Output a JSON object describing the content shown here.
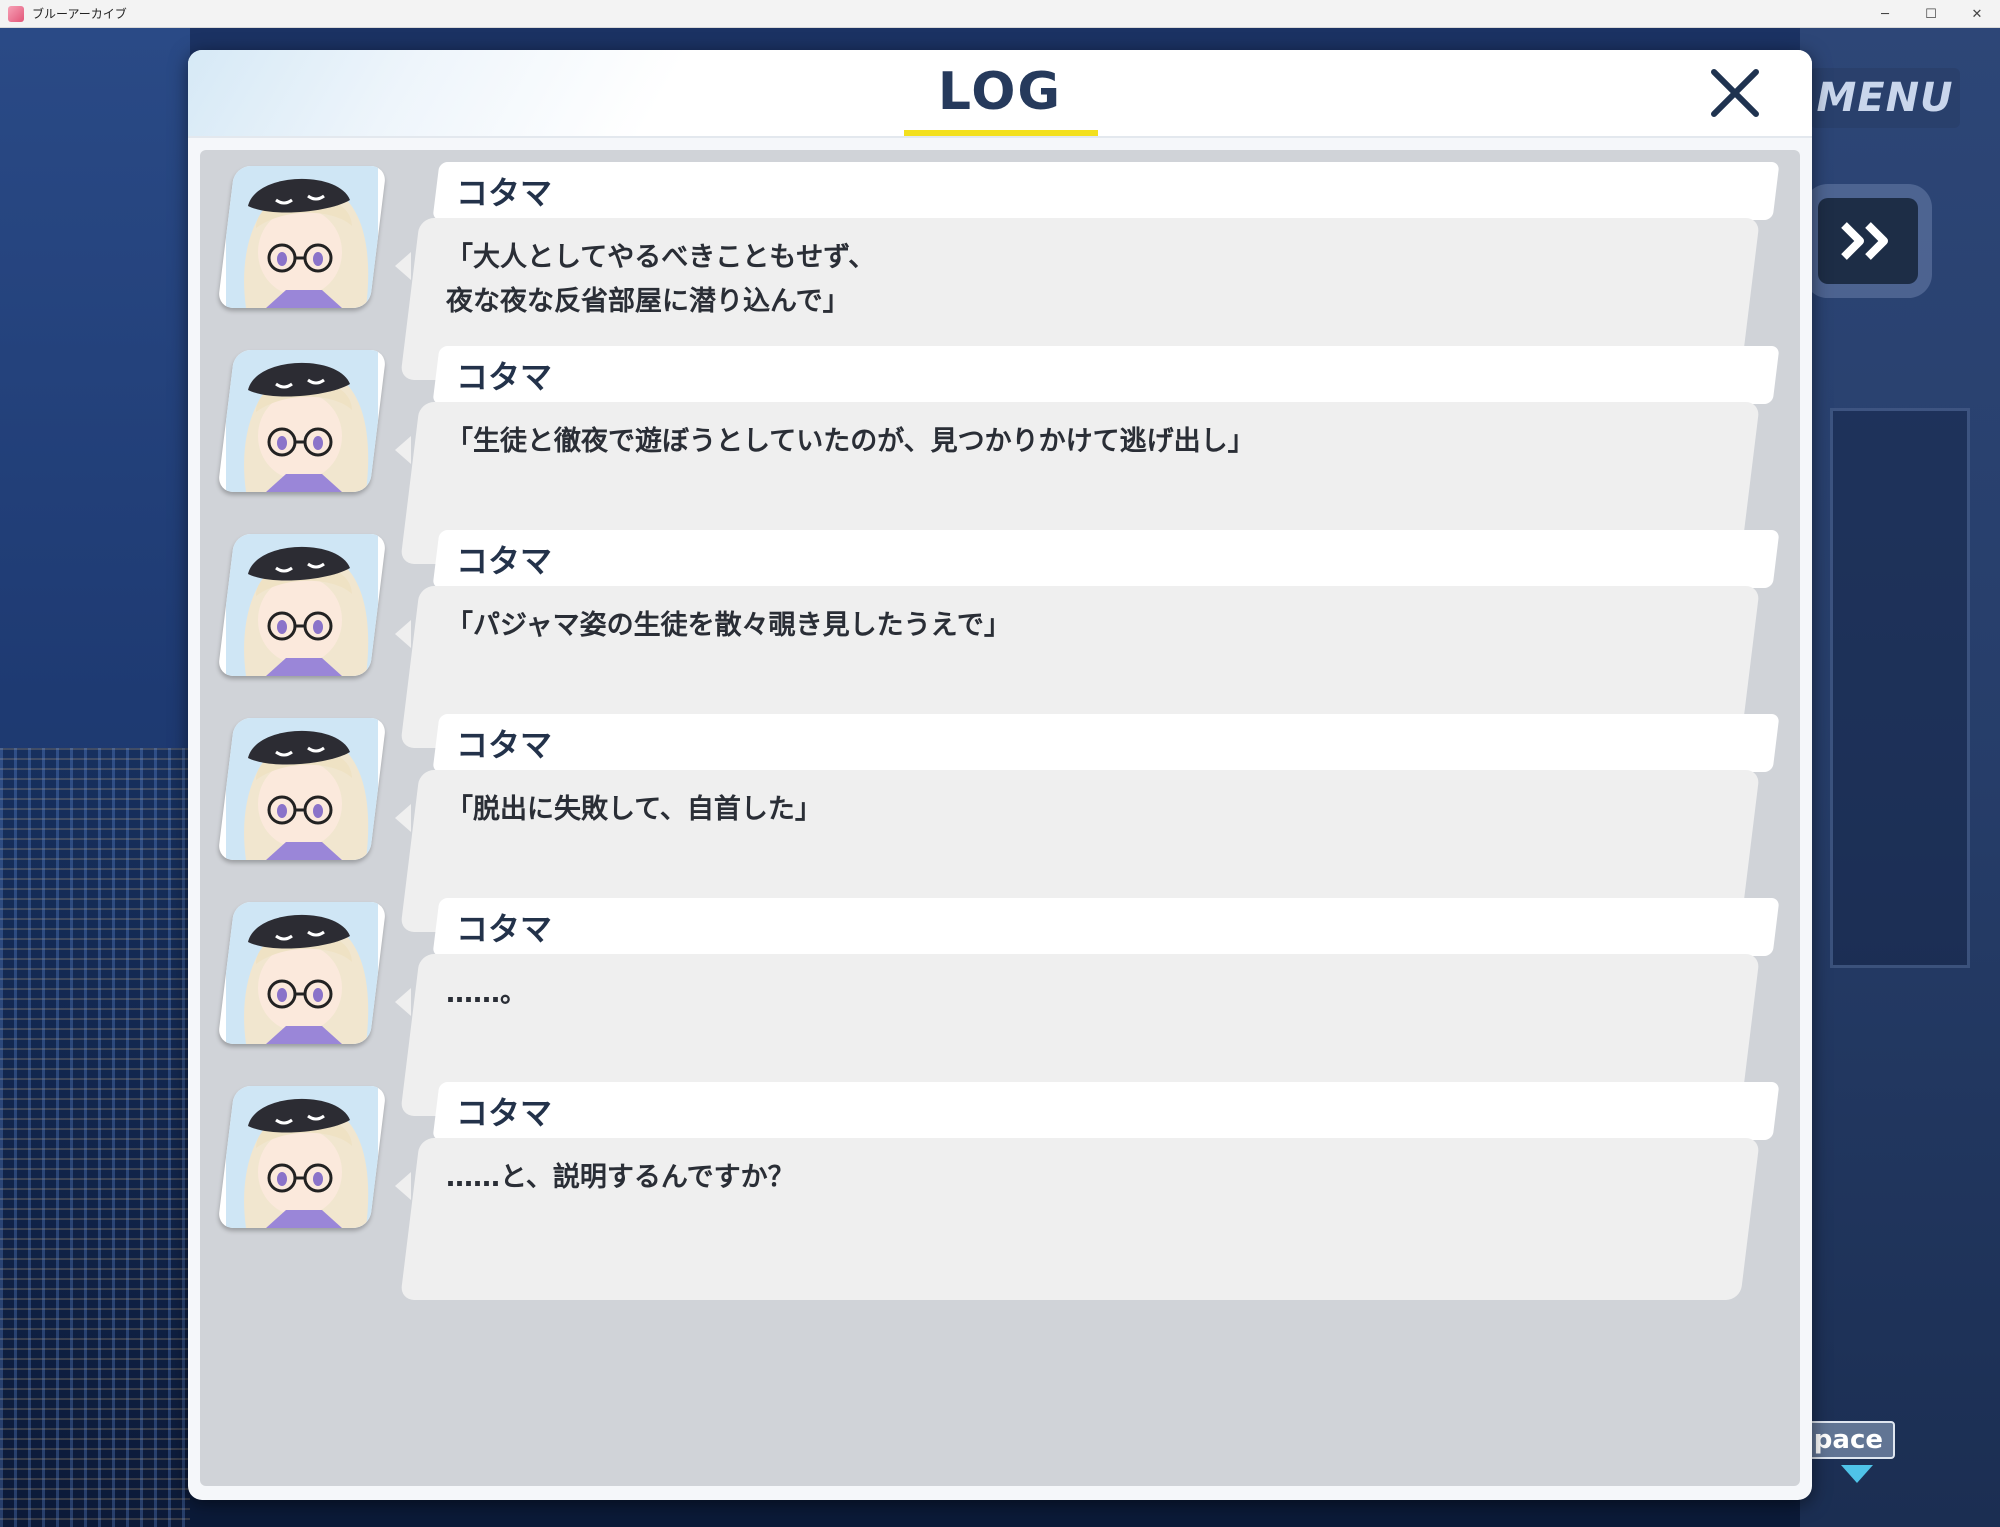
{
  "window": {
    "title": "ブルーアーカイブ",
    "controls": {
      "minimize": "─",
      "maximize": "☐",
      "close": "✕"
    }
  },
  "game": {
    "menu_label": "MENU",
    "space_label": "Space"
  },
  "log": {
    "title": "LOG",
    "entries": [
      {
        "speaker": "コタマ",
        "text": "「大人としてやるべきこともせず、\n夜な夜な反省部屋に潜り込んで」"
      },
      {
        "speaker": "コタマ",
        "text": "「生徒と徹夜で遊ぼうとしていたのが、見つかりかけて逃げ出し」"
      },
      {
        "speaker": "コタマ",
        "text": "「パジャマ姿の生徒を散々覗き見したうえで」"
      },
      {
        "speaker": "コタマ",
        "text": "「脱出に失敗して、自首した」"
      },
      {
        "speaker": "コタマ",
        "text": "……。"
      },
      {
        "speaker": "コタマ",
        "text": "……と、説明するんですか？"
      }
    ]
  },
  "colors": {
    "accent_underline": "#f3e01e",
    "title_text": "#263a5c",
    "space_arrow": "#4fc3e8"
  }
}
